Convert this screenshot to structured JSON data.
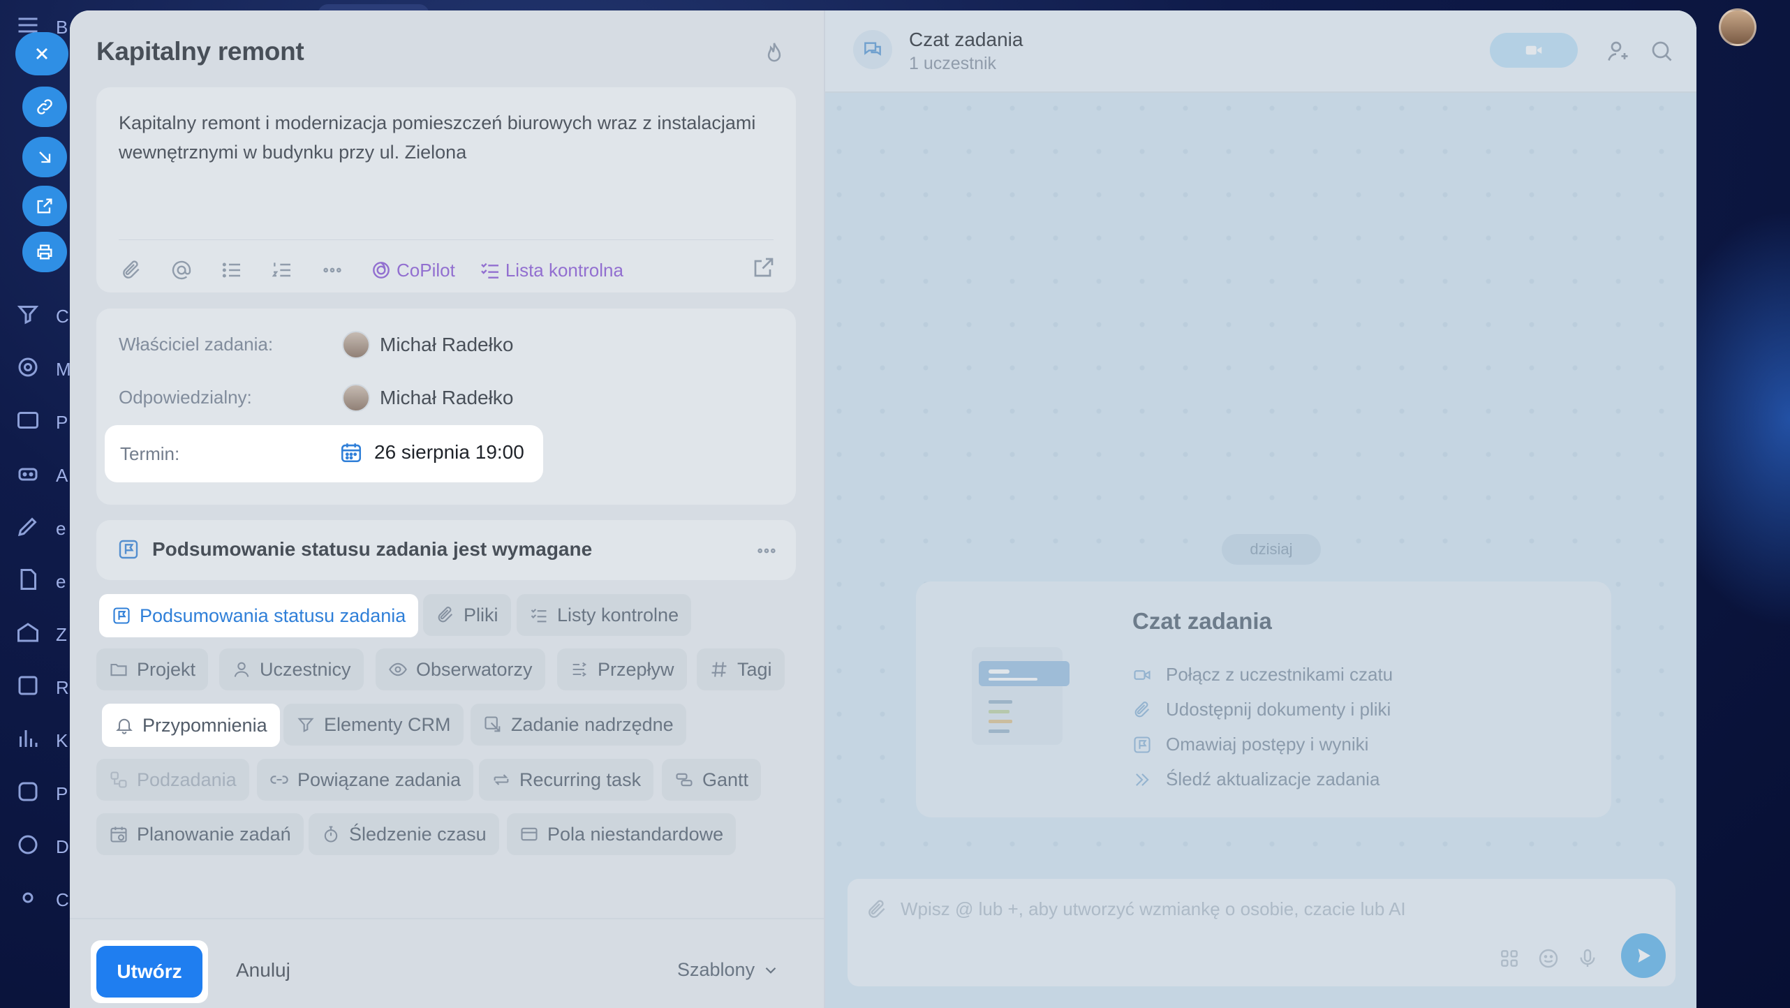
{
  "task": {
    "title": "Kapitalny remont",
    "description": "Kapitalny remont i modernizacja pomieszczeń biurowych wraz z instalacjami wewnętrznymi w budynku przy ul. Zielona"
  },
  "toolbar": {
    "copilot_label": "CoPilot",
    "checklist_label": "Lista kontrolna"
  },
  "fields": {
    "owner_label": "Właściciel zadania:",
    "owner_value": "Michał Radełko",
    "responsible_label": "Odpowiedzialny:",
    "responsible_value": "Michał Radełko",
    "deadline_label": "Termin:",
    "deadline_value": "26 sierpnia 19:00"
  },
  "summary": {
    "text": "Podsumowanie statusu zadania jest wymagane"
  },
  "chips": [
    {
      "label": "Podsumowania statusu zadania",
      "icon": "flag-square-icon",
      "state": "active"
    },
    {
      "label": "Pliki",
      "icon": "paperclip-icon",
      "state": "normal"
    },
    {
      "label": "Listy kontrolne",
      "icon": "checklist-icon",
      "state": "normal"
    },
    {
      "label": "Projekt",
      "icon": "folder-icon",
      "state": "normal"
    },
    {
      "label": "Uczestnicy",
      "icon": "user-icon",
      "state": "normal"
    },
    {
      "label": "Obserwatorzy",
      "icon": "eye-icon",
      "state": "normal"
    },
    {
      "label": "Przepływ",
      "icon": "flow-icon",
      "state": "normal"
    },
    {
      "label": "Tagi",
      "icon": "hash-icon",
      "state": "normal"
    },
    {
      "label": "Przypomnienia",
      "icon": "bell-icon",
      "state": "highlighted"
    },
    {
      "label": "Elementy CRM",
      "icon": "crm-icon",
      "state": "normal"
    },
    {
      "label": "Zadanie nadrzędne",
      "icon": "parent-task-icon",
      "state": "normal"
    },
    {
      "label": "Podzadania",
      "icon": "subtasks-icon",
      "state": "disabled"
    },
    {
      "label": "Powiązane zadania",
      "icon": "link-icon",
      "state": "normal"
    },
    {
      "label": "Recurring task",
      "icon": "repeat-icon",
      "state": "normal"
    },
    {
      "label": "Gantt",
      "icon": "gantt-icon",
      "state": "normal"
    },
    {
      "label": "Planowanie zadań",
      "icon": "calendar-plan-icon",
      "state": "normal"
    },
    {
      "label": "Śledzenie czasu",
      "icon": "stopwatch-icon",
      "state": "normal"
    },
    {
      "label": "Pola niestandardowe",
      "icon": "custom-fields-icon",
      "state": "normal"
    }
  ],
  "footer": {
    "create_label": "Utwórz",
    "cancel_label": "Anuluj",
    "templates_label": "Szablony"
  },
  "chat": {
    "title": "Czat zadania",
    "subtitle": "1 uczestnik",
    "day_badge": "dzisiaj",
    "welcome_title": "Czat zadania",
    "features": [
      {
        "label": "Połącz z uczestnikami czatu",
        "icon": "video-icon"
      },
      {
        "label": "Udostępnij dokumenty i pliki",
        "icon": "paperclip-icon"
      },
      {
        "label": "Omawiaj postępy i wyniki",
        "icon": "flag-square-icon"
      },
      {
        "label": "Śledź aktualizacje zadania",
        "icon": "double-chevron-icon"
      }
    ],
    "composer_placeholder": "Wpisz @ lub +, aby utworzyć wzmiankę o osobie, czacie lub AI"
  },
  "background_sidebar": {
    "letters": [
      "B",
      "C",
      "M",
      "P",
      "A",
      "e",
      "e",
      "Z",
      "R",
      "K",
      "P",
      "D",
      "C"
    ]
  },
  "colors": {
    "accent": "#1f7ef0",
    "copilot": "#8c52d9",
    "chat_bg": "#d7e8f3"
  }
}
